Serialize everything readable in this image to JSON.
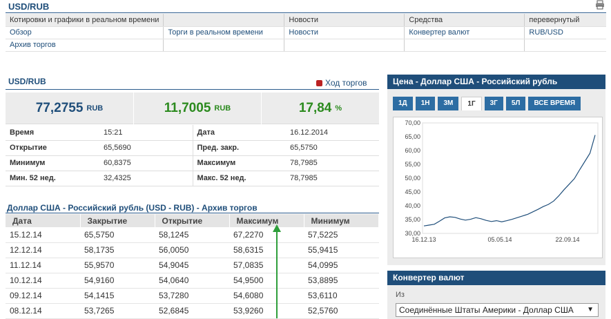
{
  "header": {
    "title": "USD/RUB",
    "print_icon": "printer-icon"
  },
  "nav": {
    "headers": [
      "Котировки и графики в реальном времени",
      "",
      "Новости",
      "Средства",
      "перевернутый"
    ],
    "row1": [
      "Обзор",
      "Торги в реальном времени",
      "Новости",
      "Конвертер валют",
      "RUB/USD"
    ],
    "row2": [
      "Архив торгов",
      "",
      "",
      "",
      ""
    ]
  },
  "summary": {
    "title": "USD/RUB",
    "trading_link": "Ход торгов",
    "price": "77,2755",
    "price_unit": "RUB",
    "change": "11,7005",
    "change_unit": "RUB",
    "change_pct": "17,84",
    "pct_unit": "%",
    "colors": {
      "price": "#1f4e7a",
      "change": "#2b8a1e"
    }
  },
  "info": [
    {
      "l1": "Время",
      "v1": "15:21",
      "l2": "Дата",
      "v2": "16.12.2014"
    },
    {
      "l1": "Открытие",
      "v1": "65,5690",
      "l2": "Пред. закр.",
      "v2": "65,5750"
    },
    {
      "l1": "Минимум",
      "v1": "60,8375",
      "l2": "Максимум",
      "v2": "78,7985"
    },
    {
      "l1": "Мин. 52 нед.",
      "v1": "32,4325",
      "l2": "Макс. 52 нед.",
      "v2": "78,7985"
    }
  ],
  "history": {
    "title": "Доллар США - Российский рубль (USD - RUB) - Архив торгов",
    "columns": [
      "Дата",
      "Закрытие",
      "Открытие",
      "Максимум",
      "Минимум"
    ],
    "rows": [
      [
        "15.12.14",
        "65,5750",
        "58,1245",
        "67,2270",
        "57,5225"
      ],
      [
        "12.12.14",
        "58,1735",
        "56,0050",
        "58,6315",
        "55,9415"
      ],
      [
        "11.12.14",
        "55,9570",
        "54,9045",
        "57,0835",
        "54,0995"
      ],
      [
        "10.12.14",
        "54,9160",
        "54,0640",
        "54,9500",
        "53,8895"
      ],
      [
        "09.12.14",
        "54,1415",
        "53,7280",
        "54,6080",
        "53,6110"
      ],
      [
        "08.12.14",
        "53,7265",
        "52,6845",
        "53,9260",
        "52,5760"
      ]
    ]
  },
  "chart_panel": {
    "title": "Цена - Доллар США - Российский рубль",
    "tabs": [
      "1Д",
      "1Н",
      "3М",
      "1Г",
      "3Г",
      "5Л",
      "ВСЕ ВРЕМЯ"
    ],
    "active_tab": "1Г"
  },
  "chart_data": {
    "type": "line",
    "y_ticks": [
      "70,00",
      "65,00",
      "60,00",
      "55,00",
      "50,00",
      "45,00",
      "40,00",
      "35,00",
      "30,00"
    ],
    "x_ticks": [
      "16.12.13",
      "05.05.14",
      "22.09.14"
    ],
    "ylim": [
      30,
      70
    ],
    "series_color": "#1f4e7a",
    "series": [
      {
        "values": [
          32.7,
          33.0,
          33.3,
          34.4,
          35.6,
          36.0,
          35.8,
          35.2,
          34.8,
          35.1,
          35.7,
          35.3,
          34.7,
          34.3,
          34.6,
          34.2,
          34.6,
          35.1,
          35.7,
          36.3,
          36.9,
          37.8,
          38.7,
          39.7,
          40.5,
          41.7,
          43.6,
          45.8,
          47.8,
          49.8,
          53.0,
          56.0,
          59.0,
          65.6
        ]
      }
    ]
  },
  "converter": {
    "title": "Конвертер валют",
    "from_label": "Из",
    "from_value": "Соединённые Штаты Америки - Доллар США"
  }
}
